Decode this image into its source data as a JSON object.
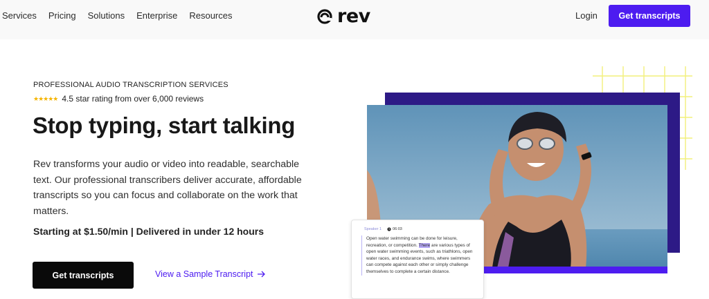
{
  "nav": {
    "links": [
      "Services",
      "Pricing",
      "Solutions",
      "Enterprise",
      "Resources"
    ],
    "logo_text": "rev",
    "login_label": "Login",
    "cta_label": "Get transcripts"
  },
  "hero": {
    "eyebrow": "PROFESSIONAL AUDIO TRANSCRIPTION SERVICES",
    "rating_text": "4.5 star rating from over 6,000 reviews",
    "rating_value": 4.5,
    "title": "Stop typing, start talking",
    "description": "Rev transforms your audio or video into readable, searchable text. Our professional transcribers deliver accurate, affordable transcripts so you can focus and collaborate on the work that matters.",
    "price_line": "Starting at $1.50/min | Delivered in under 12 hours",
    "cta_label": "Get transcripts",
    "sample_link": "View a Sample Transcript"
  },
  "transcript_card": {
    "speaker": "Speaker 1",
    "time": "06:03",
    "text_before": "Open water swimming can be done for leisure, recreation, or competition. ",
    "highlight": "There",
    "text_after": " are various types of open water swimming events, such as triathlons, open water races, and endurance swims, where swimmers can compete against each other or simply challenge themselves to complete a certain distance."
  },
  "colors": {
    "brand_purple": "#4d1cf0",
    "dark_purple": "#2d1a86",
    "grid_yellow": "#f2f07a"
  }
}
